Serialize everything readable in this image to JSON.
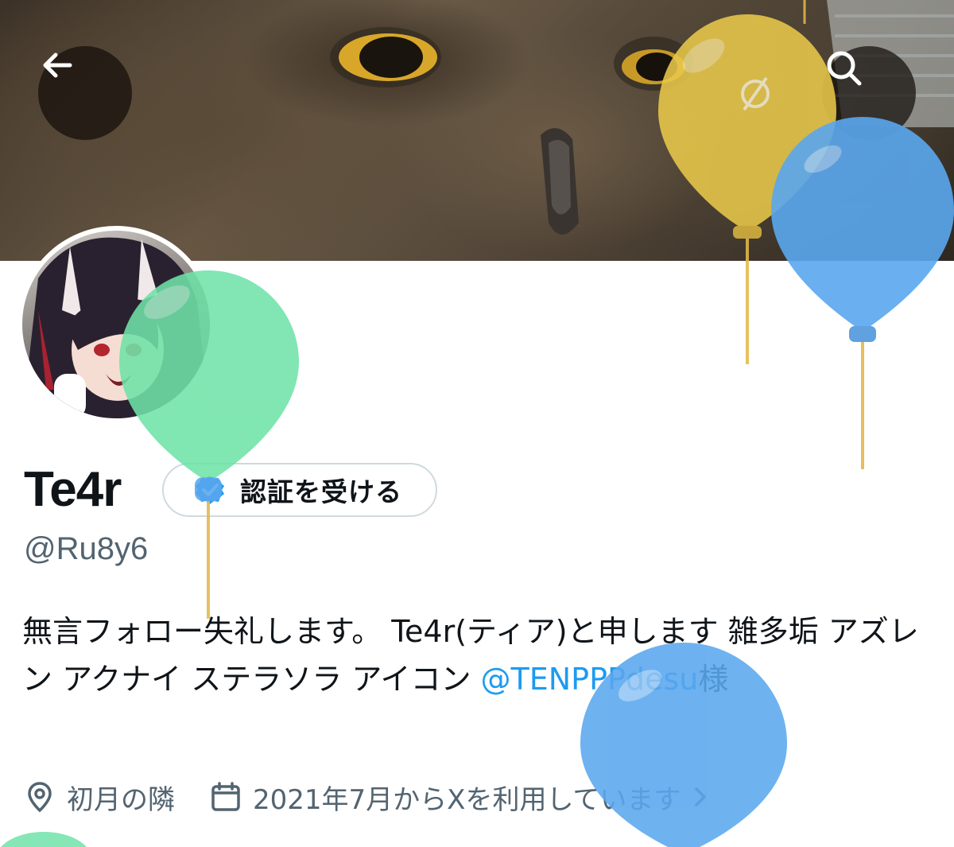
{
  "header": {
    "back_icon": "arrow-left-icon",
    "search_icon": "search-icon"
  },
  "profile": {
    "display_name": "Te4r",
    "handle": "@Ru8y6",
    "verify_button_label": "認証を受ける",
    "bio": {
      "text": "無言フォロー失礼します。 Te4r(ティア)と申します 雑多垢 アズレン アクナイ ステラソラ アイコン ",
      "mention": "@TENPPPdesu",
      "suffix": "様"
    },
    "location": "初月の隣",
    "joined": "2021年7月からXを利用しています"
  },
  "colors": {
    "accent": "#1d9bf0",
    "text_primary": "#0f1419",
    "text_secondary": "#536471",
    "balloon_yellow": "#e8c84a",
    "balloon_blue": "#5aa7ee",
    "balloon_green": "#6fe3a8"
  }
}
